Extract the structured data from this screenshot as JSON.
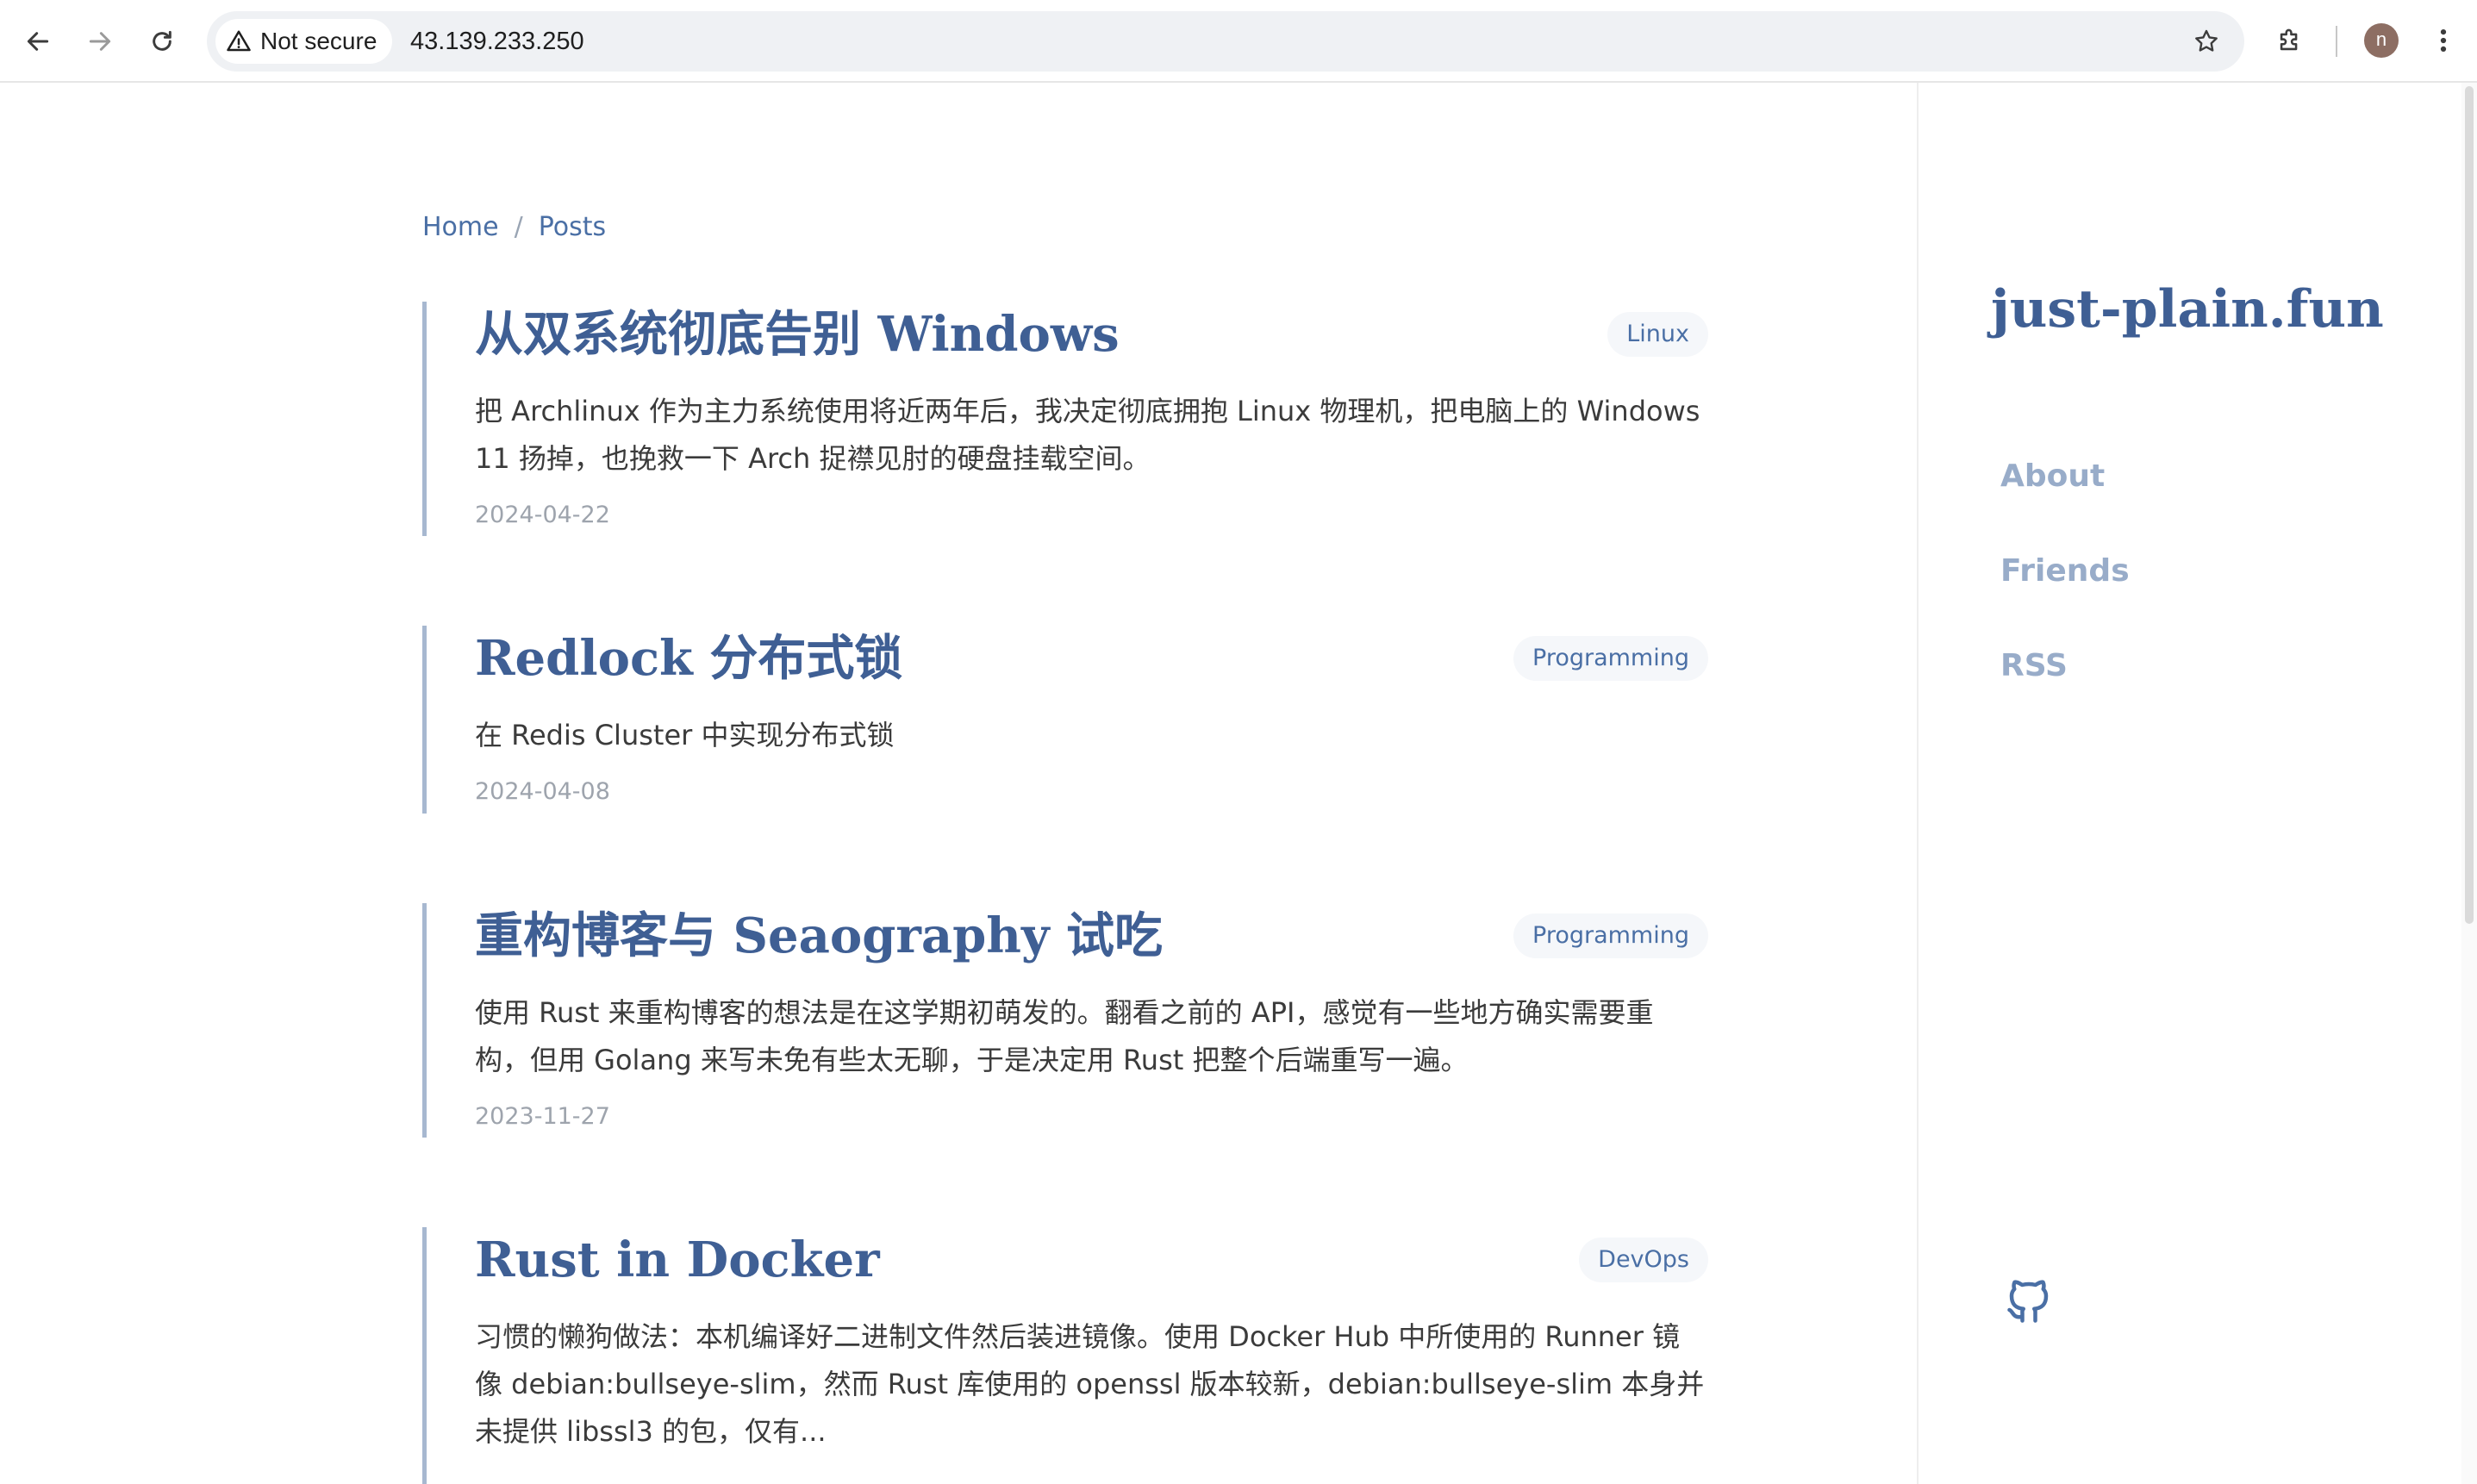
{
  "browser": {
    "security_label": "Not secure",
    "url": "43.139.233.250",
    "profile_initial": "n"
  },
  "breadcrumb": {
    "home": "Home",
    "separator": "/",
    "posts": "Posts"
  },
  "posts": [
    {
      "title": "从双系统彻底告别 Windows",
      "tag": "Linux",
      "summary": "把 Archlinux 作为主力系统使用将近两年后，我决定彻底拥抱 Linux 物理机，把电脑上的 Windows 11 扬掉，也挽救一下 Arch 捉襟见肘的硬盘挂载空间。",
      "date": "2024-04-22"
    },
    {
      "title": "Redlock 分布式锁",
      "tag": "Programming",
      "summary": "在 Redis Cluster 中实现分布式锁",
      "date": "2024-04-08"
    },
    {
      "title": "重构博客与 Seaography 试吃",
      "tag": "Programming",
      "summary": "使用 Rust 来重构博客的想法是在这学期初萌发的。翻看之前的 API，感觉有一些地方确实需要重构，但用 Golang 来写未免有些太无聊，于是决定用 Rust 把整个后端重写一遍。",
      "date": "2023-11-27"
    },
    {
      "title": "Rust in Docker",
      "tag": "DevOps",
      "summary": "习惯的懒狗做法：本机编译好二进制文件然后装进镜像。使用 Docker Hub 中所使用的 Runner 镜像 debian:bullseye-slim，然而 Rust 库使用的 openssl 版本较新，debian:bullseye-slim 本身并未提供 libssl3 的包，仅有...",
      "date": ""
    }
  ],
  "sidebar": {
    "site_title": "just-plain.fun",
    "links": [
      "About",
      "Friends",
      "RSS"
    ],
    "github_icon": "github-icon"
  },
  "colors": {
    "accent": "#3f5f94",
    "link": "#4a6fa5",
    "sidebar_link": "#98acc9",
    "post_border": "#a7b8d0"
  }
}
